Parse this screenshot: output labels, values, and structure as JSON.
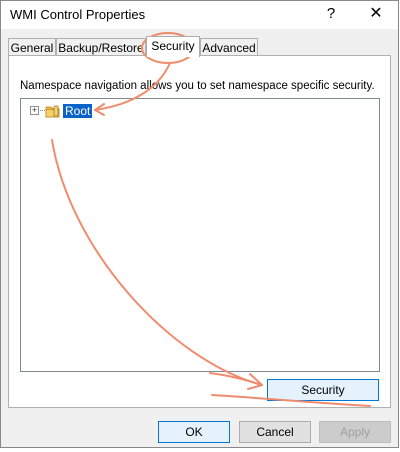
{
  "window": {
    "title": "WMI Control Properties",
    "help_symbol": "?",
    "close_symbol": "✕"
  },
  "tabs": [
    {
      "label": "General"
    },
    {
      "label": "Backup/Restore"
    },
    {
      "label": "Security"
    },
    {
      "label": "Advanced"
    }
  ],
  "security": {
    "description": "Namespace navigation allows you to set namespace specific security.",
    "tree": {
      "expander": "+",
      "root_label": "Root"
    },
    "security_button": "Security"
  },
  "buttons": {
    "ok": "OK",
    "cancel": "Cancel",
    "apply": "Apply"
  },
  "colors": {
    "selection": "#0a64c8",
    "annotation": "#f08c6e",
    "focus_border": "#0078d7"
  }
}
